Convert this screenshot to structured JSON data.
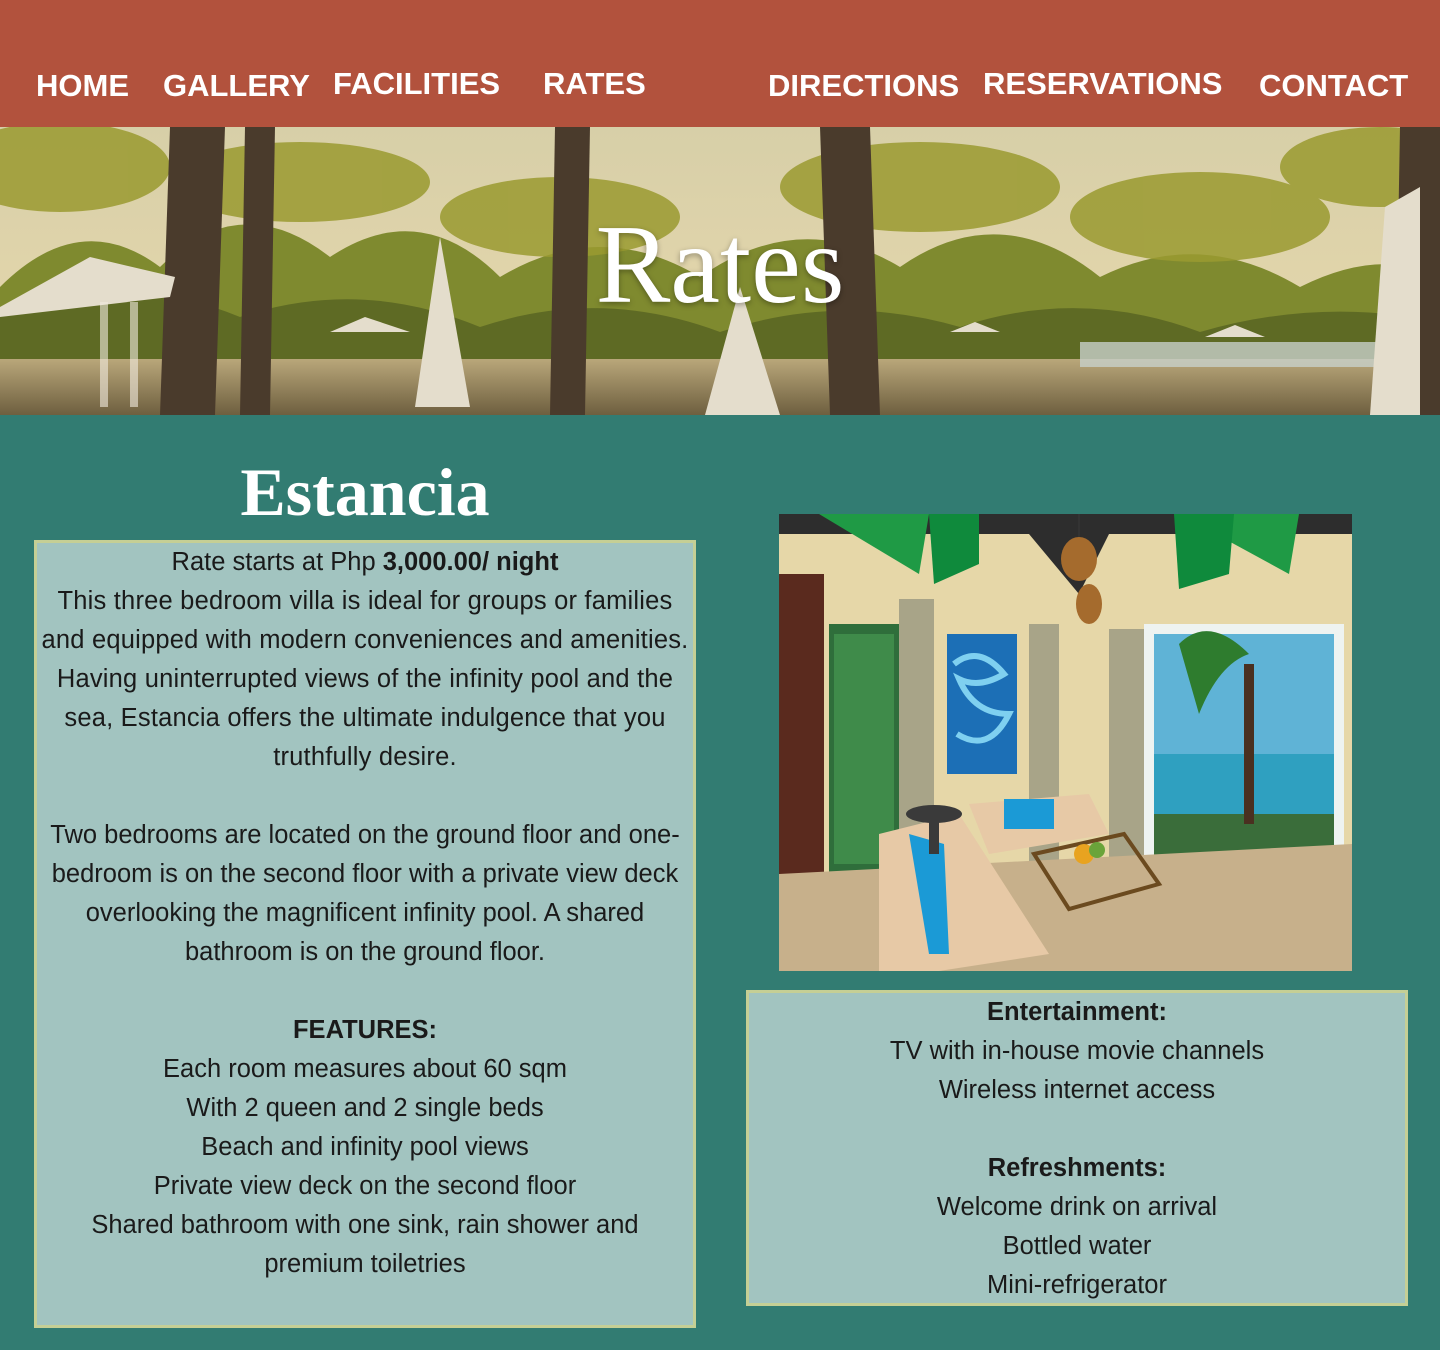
{
  "nav": {
    "items": [
      {
        "label": "HOME"
      },
      {
        "label": "GALLERY"
      },
      {
        "label": "FACILITIES"
      },
      {
        "label": "RATES"
      },
      {
        "label": "DIRECTIONS"
      },
      {
        "label": "RESERVATIONS"
      },
      {
        "label": "CONTACT"
      }
    ]
  },
  "hero": {
    "title": "Rates"
  },
  "villa": {
    "name": "Estancia",
    "rate_prefix": "Rate starts at Php ",
    "rate_value": "3,000.00/ night",
    "description": "This three bedroom villa is ideal for groups or families and equipped with modern conveniences and amenities. Having uninterrupted views of the infinity pool and the sea, Estancia offers the ultimate indulgence that you truthfully desire.",
    "description2": "Two bedrooms are located on the ground floor and one-bedroom is on the second floor with a private view deck overlooking the magnificent infinity pool.  A shared bathroom is on the ground floor.",
    "features_heading": "FEATURES:",
    "features": [
      "Each room measures about 60 sqm",
      "With 2 queen and 2 single beds",
      "Beach and infinity pool views",
      "Private view deck on the second floor",
      "Shared bathroom with one sink, rain shower and premium toiletries"
    ]
  },
  "amenities": {
    "entertainment_heading": "Entertainment:",
    "entertainment": [
      "TV with in-house movie channels",
      "Wireless internet access"
    ],
    "refreshments_heading": "Refreshments:",
    "refreshments": [
      "Welcome drink on arrival",
      "Bottled water",
      "Mini-refrigerator"
    ]
  },
  "colors": {
    "nav_bg": "#b2523d",
    "page_bg": "#327c72",
    "box_bg": "#a2c4c0",
    "box_border": "#c5cf95"
  }
}
